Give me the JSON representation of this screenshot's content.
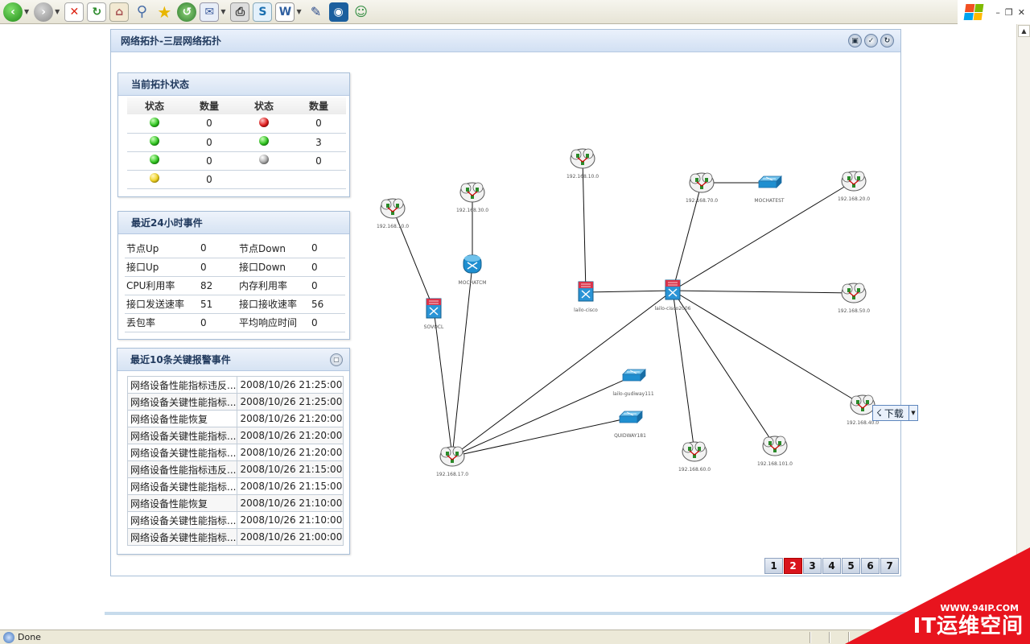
{
  "browser": {
    "status_text": "Done"
  },
  "panel": {
    "title": "网络拓扑-三层网络拓扑"
  },
  "status_box": {
    "title": "当前拓扑状态",
    "headers": [
      "状态",
      "数量",
      "状态",
      "数量"
    ],
    "rows": [
      {
        "left_color": "green",
        "left_count": "0",
        "right_color": "red",
        "right_count": "0"
      },
      {
        "left_color": "green",
        "left_count": "0",
        "right_color": "green",
        "right_count": "3"
      },
      {
        "left_color": "green",
        "left_count": "0",
        "right_color": "gray",
        "right_count": "0"
      },
      {
        "left_color": "yellow",
        "left_count": "0",
        "right_color": "",
        "right_count": ""
      }
    ]
  },
  "events_box": {
    "title": "最近24小时事件",
    "rows": [
      {
        "l_label": "节点Up",
        "l_val": "0",
        "r_label": "节点Down",
        "r_val": "0"
      },
      {
        "l_label": "接口Up",
        "l_val": "0",
        "r_label": "接口Down",
        "r_val": "0"
      },
      {
        "l_label": "CPU利用率",
        "l_val": "82",
        "r_label": "内存利用率",
        "r_val": "0"
      },
      {
        "l_label": "接口发送速率",
        "l_val": "51",
        "r_label": "接口接收速率",
        "r_val": "56"
      },
      {
        "l_label": "丢包率",
        "l_val": "0",
        "r_label": "平均响应时间",
        "r_val": "0"
      }
    ]
  },
  "alarms_box": {
    "title": "最近10条关键报警事件",
    "rows": [
      {
        "name": "网络设备性能指标违反...",
        "time": "2008/10/26 21:25:00"
      },
      {
        "name": "网络设备关键性能指标...",
        "time": "2008/10/26 21:25:00"
      },
      {
        "name": "网络设备性能恢复",
        "time": "2008/10/26 21:20:00"
      },
      {
        "name": "网络设备关键性能指标...",
        "time": "2008/10/26 21:20:00"
      },
      {
        "name": "网络设备关键性能指标...",
        "time": "2008/10/26 21:20:00"
      },
      {
        "name": "网络设备性能指标违反...",
        "time": "2008/10/26 21:15:00"
      },
      {
        "name": "网络设备关键性能指标...",
        "time": "2008/10/26 21:15:00"
      },
      {
        "name": "网络设备性能恢复",
        "time": "2008/10/26 21:10:00"
      },
      {
        "name": "网络设备关键性能指标...",
        "time": "2008/10/26 21:10:00"
      },
      {
        "name": "网络设备关键性能指标...",
        "time": "2008/10/26 21:00:00"
      }
    ]
  },
  "topology": {
    "nodes": [
      {
        "id": "n1",
        "type": "cloud",
        "label": "192.168.10.0"
      },
      {
        "id": "n2",
        "type": "cloud",
        "label": "192.168.30.0"
      },
      {
        "id": "n3",
        "type": "cloud",
        "label": "192.168.10.0"
      },
      {
        "id": "n4",
        "type": "cloud",
        "label": "192.168.70.0"
      },
      {
        "id": "n5",
        "type": "switch",
        "label": "MOCHATEST"
      },
      {
        "id": "n6",
        "type": "cloud",
        "label": "192.168.20.0"
      },
      {
        "id": "n7",
        "type": "router",
        "label": "MOCHATCM"
      },
      {
        "id": "n8",
        "type": "l3switch",
        "label": "SOVOCL"
      },
      {
        "id": "n9",
        "type": "l3switch",
        "label": "lailo-cisco"
      },
      {
        "id": "n10",
        "type": "l3switch",
        "label": "lailo-cisco2006"
      },
      {
        "id": "n11",
        "type": "cloud",
        "label": "192.168.50.0"
      },
      {
        "id": "n12",
        "type": "switch",
        "label": "lailo-gudiway111"
      },
      {
        "id": "n13",
        "type": "switch",
        "label": "QUIDWAY181"
      },
      {
        "id": "n14",
        "type": "cloud",
        "label": "192.168.40.0"
      },
      {
        "id": "n15",
        "type": "cloud",
        "label": "192.168.17.0"
      },
      {
        "id": "n16",
        "type": "cloud",
        "label": "192.168.60.0"
      },
      {
        "id": "n17",
        "type": "cloud",
        "label": "192.168.101.0"
      }
    ],
    "links": [
      [
        "n1",
        "n8"
      ],
      [
        "n8",
        "n15"
      ],
      [
        "n2",
        "n7"
      ],
      [
        "n7",
        "n15"
      ],
      [
        "n15",
        "n10"
      ],
      [
        "n15",
        "n12"
      ],
      [
        "n15",
        "n13"
      ],
      [
        "n3",
        "n9"
      ],
      [
        "n9",
        "n10"
      ],
      [
        "n4",
        "n5"
      ],
      [
        "n4",
        "n10"
      ],
      [
        "n6",
        "n10"
      ],
      [
        "n11",
        "n10"
      ],
      [
        "n14",
        "n10"
      ],
      [
        "n16",
        "n10"
      ],
      [
        "n17",
        "n10"
      ]
    ]
  },
  "pagination": {
    "pages": [
      "1",
      "2",
      "3",
      "4",
      "5",
      "6",
      "7"
    ],
    "active": "2"
  },
  "tooltip": {
    "label": "下载"
  },
  "watermark": {
    "url": "WWW.94IP.COM",
    "name": "IT运维空间"
  }
}
